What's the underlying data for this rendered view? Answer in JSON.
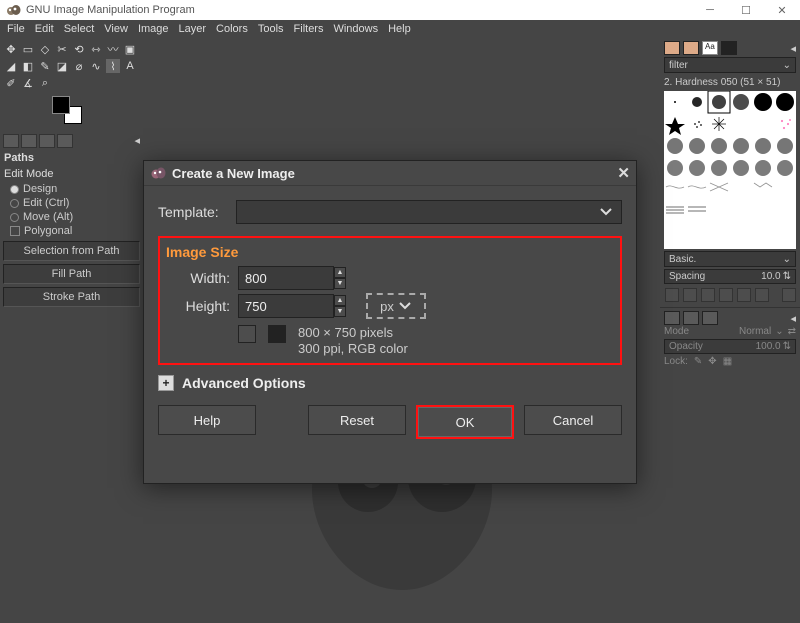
{
  "window": {
    "title": "GNU Image Manipulation Program"
  },
  "menubar": [
    "File",
    "Edit",
    "Select",
    "View",
    "Image",
    "Layer",
    "Colors",
    "Tools",
    "Filters",
    "Windows",
    "Help"
  ],
  "left": {
    "paths_title": "Paths",
    "edit_mode_title": "Edit Mode",
    "modes": [
      {
        "label": "Design",
        "on": true
      },
      {
        "label": "Edit (Ctrl)",
        "on": false
      },
      {
        "label": "Move (Alt)",
        "on": false
      }
    ],
    "polygonal": "Polygonal",
    "buttons": [
      "Selection from Path",
      "Fill Path",
      "Stroke Path"
    ]
  },
  "right": {
    "filter_label": "filter",
    "brush_name": "2. Hardness 050 (51 × 51)",
    "basic_label": "Basic.",
    "spacing_label": "Spacing",
    "spacing_value": "10.0",
    "mode_label": "Mode",
    "mode_value": "Normal",
    "opacity_label": "Opacity",
    "opacity_value": "100.0",
    "lock_label": "Lock:"
  },
  "dialog": {
    "title": "Create a New Image",
    "template_label": "Template:",
    "group_title": "Image Size",
    "width_label": "Width:",
    "width_value": "800",
    "height_label": "Height:",
    "height_value": "750",
    "unit": "px",
    "info_line1": "800 × 750 pixels",
    "info_line2": "300 ppi, RGB color",
    "advanced_label": "Advanced Options",
    "buttons": {
      "help": "Help",
      "reset": "Reset",
      "ok": "OK",
      "cancel": "Cancel"
    }
  }
}
